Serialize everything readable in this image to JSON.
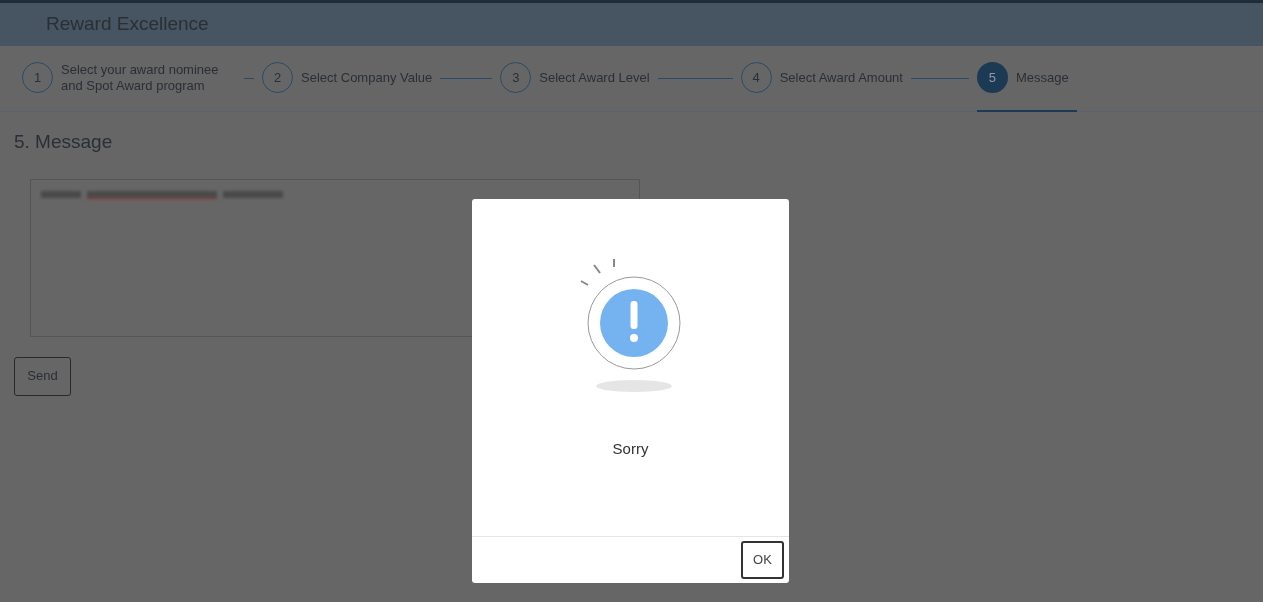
{
  "header": {
    "title": "Reward Excellence"
  },
  "steps": [
    {
      "number": "1",
      "label": "Select your award nominee and Spot Award program",
      "selected": false
    },
    {
      "number": "2",
      "label": "Select Company Value",
      "selected": false
    },
    {
      "number": "3",
      "label": "Select Award Level",
      "selected": false
    },
    {
      "number": "4",
      "label": "Select Award Amount",
      "selected": false
    },
    {
      "number": "5",
      "label": "Message",
      "selected": true
    }
  ],
  "section": {
    "heading": "5. Message"
  },
  "send_button": {
    "label": "Send"
  },
  "dialog": {
    "message": "Sorry",
    "button": "OK"
  }
}
